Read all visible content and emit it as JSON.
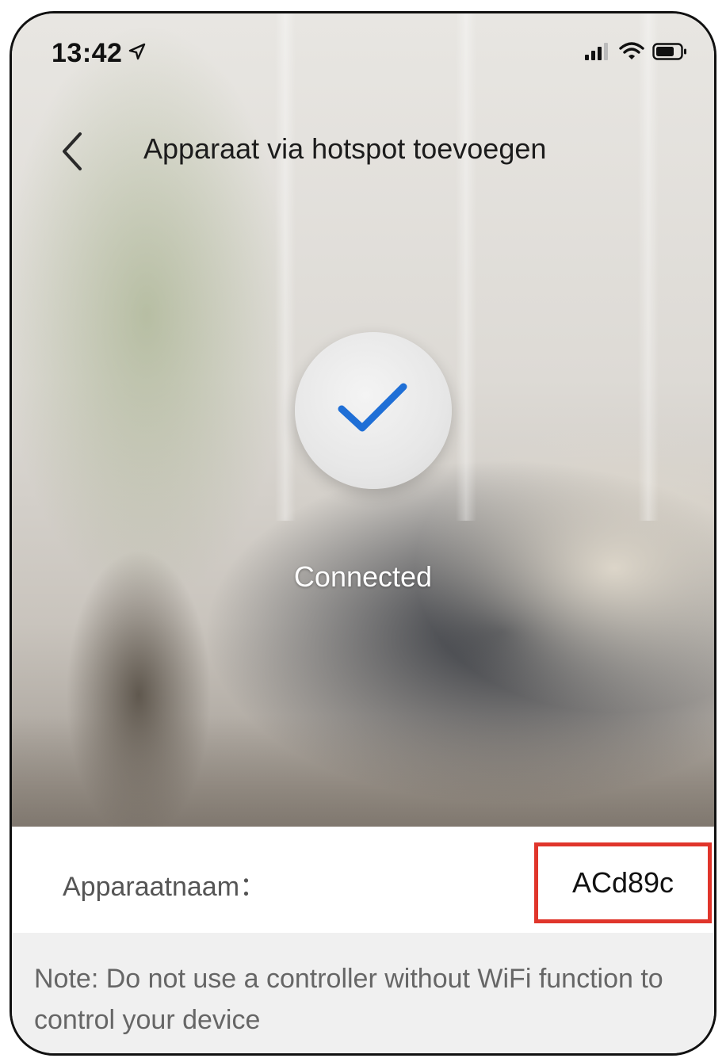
{
  "status_bar": {
    "time": "13:42",
    "location_icon": "location-arrow-icon",
    "signal_icon": "cellular-signal-icon",
    "wifi_icon": "wifi-icon",
    "battery_icon": "battery-icon"
  },
  "nav": {
    "back_icon": "chevron-left-icon",
    "title": "Apparaat via hotspot toevoegen"
  },
  "connection": {
    "status_icon": "checkmark-icon",
    "status": "Connected",
    "accent_color": "#1f6fd6"
  },
  "device": {
    "name_label": "Apparaatnaam：",
    "name_value": "ACd89c",
    "highlight_color": "#e0352b"
  },
  "note": {
    "text": "Note: Do not use a controller without WiFi function to control your device"
  }
}
